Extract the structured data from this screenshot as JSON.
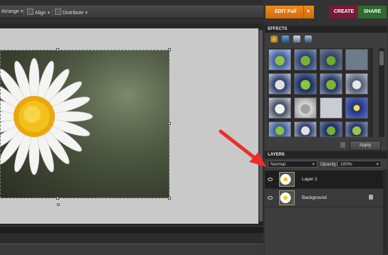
{
  "toolbar": {
    "arrange_label": "Arrange",
    "align_label": "Align",
    "distribute_label": "Distribute"
  },
  "modes": {
    "edit_label": "EDIT Full",
    "create_label": "CREATE",
    "share_label": "SHARE"
  },
  "effects": {
    "header": "EFFECTS",
    "apply_label": "Apply"
  },
  "layers": {
    "header": "LAYERS",
    "blend_mode": "Normal",
    "opacity_label": "Opacity:",
    "opacity_value": "100%",
    "items": [
      {
        "name": "Layer 1"
      },
      {
        "name": "Background"
      }
    ]
  },
  "colors": {
    "edit_orange": "#e87a14",
    "create_maroon": "#7a1a3a",
    "share_green": "#2e6b2e",
    "annotation_arrow": "#e8302a"
  }
}
